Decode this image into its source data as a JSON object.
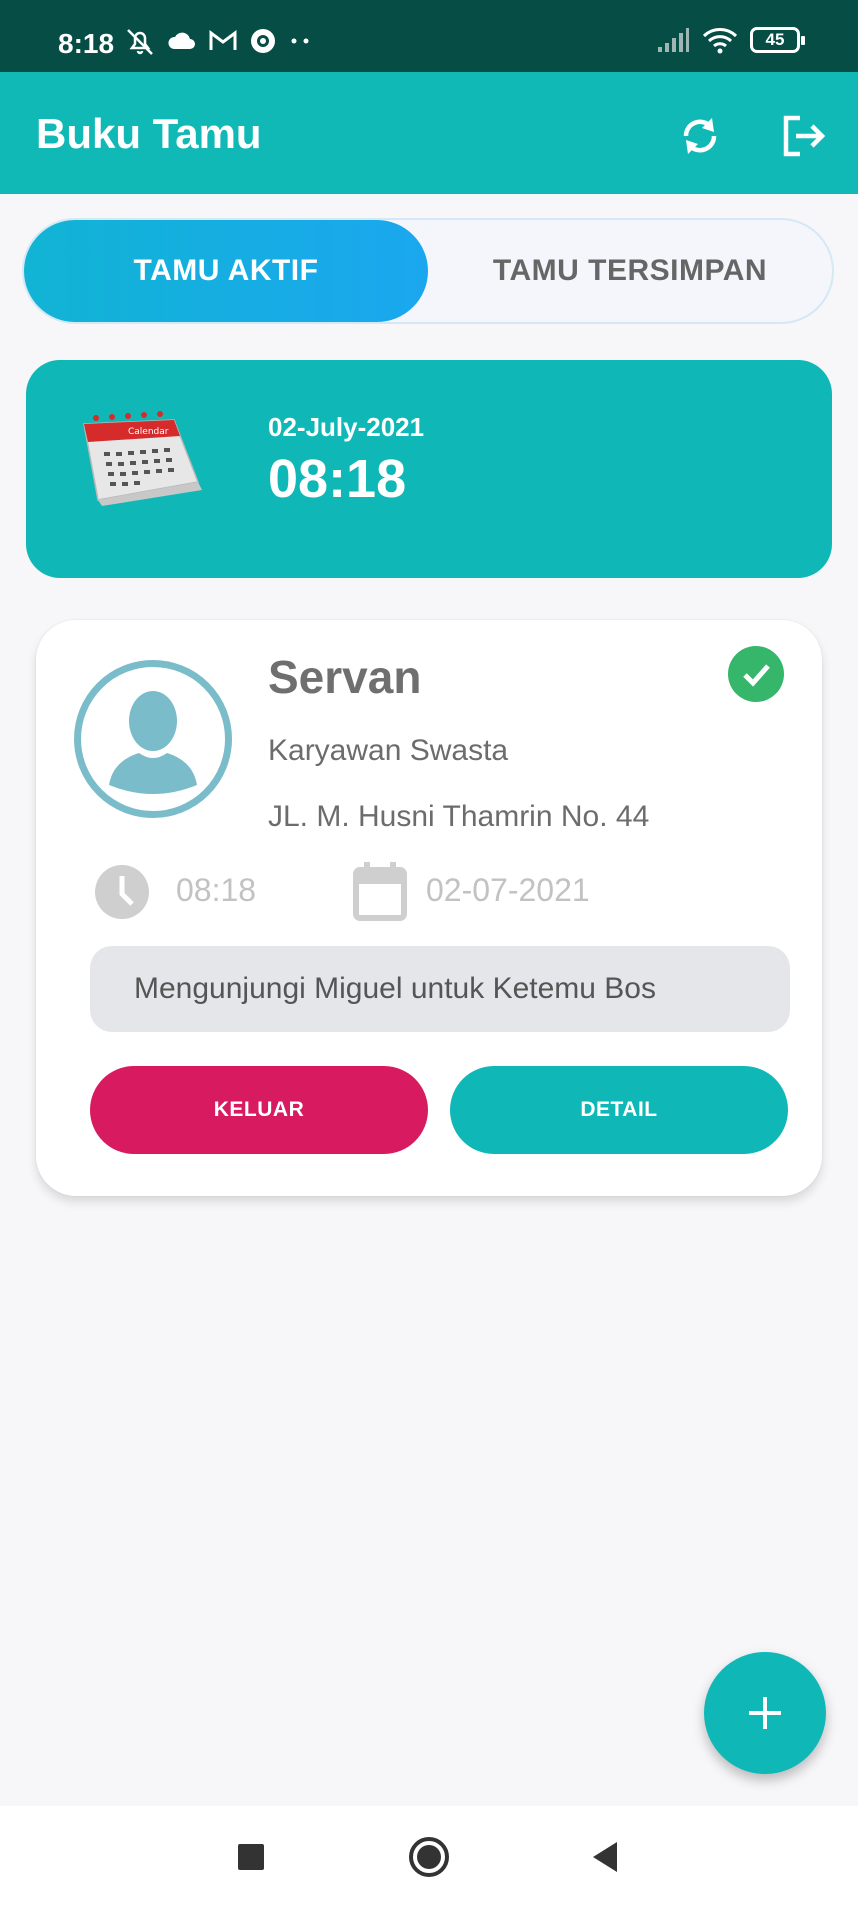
{
  "status_bar": {
    "time": "8:18",
    "battery": "45",
    "icons": [
      "bell-off-icon",
      "cloud-icon",
      "gmail-icon",
      "location-icon",
      "more-dots-icon",
      "signal-icon",
      "wifi-icon",
      "battery-icon"
    ]
  },
  "app_bar": {
    "title": "Buku Tamu",
    "actions": [
      "refresh-icon",
      "logout-icon"
    ]
  },
  "tabs": [
    {
      "label": "TAMU AKTIF",
      "active": true
    },
    {
      "label": "TAMU TERSIMPAN",
      "active": false
    }
  ],
  "date_card": {
    "date": "02-July-2021",
    "time": "08:18",
    "calendar_label": "Calendar"
  },
  "guest": {
    "name": "Servan",
    "occupation": "Karyawan Swasta",
    "address": "JL. M. Husni Thamrin No. 44",
    "time": "08:18",
    "date": "02-07-2021",
    "purpose": "Mengunjungi Miguel untuk Ketemu Bos",
    "status_icon": "check-circle-icon",
    "buttons": {
      "exit": "KELUAR",
      "detail": "DETAIL"
    }
  },
  "colors": {
    "primary": "#11b9b6",
    "status_bar": "#054d45",
    "danger": "#d81b60",
    "success": "#35b66a"
  },
  "nav_bar": [
    "recent-apps-icon",
    "home-icon",
    "back-icon"
  ]
}
